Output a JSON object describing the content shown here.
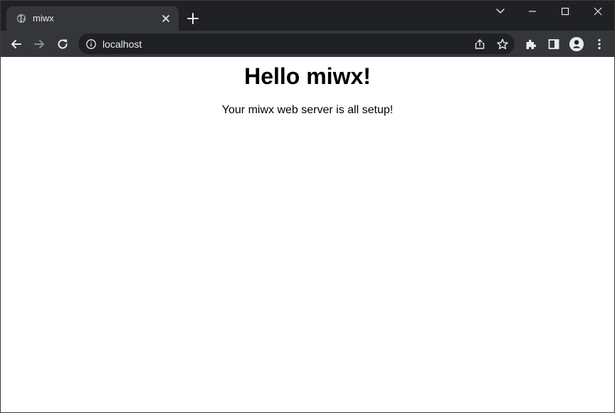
{
  "browser": {
    "tab": {
      "title": "miwx",
      "favicon": "globe-icon"
    },
    "address_bar": {
      "url": "localhost",
      "site_info_icon": "info-icon"
    },
    "toolbar_icons": [
      "back-icon",
      "forward-icon",
      "reload-icon",
      "share-icon",
      "star-icon",
      "puzzle-icon",
      "side-panel-icon",
      "profile-icon",
      "menu-dots-icon"
    ],
    "window_controls": [
      "tab-search-icon",
      "minimize-icon",
      "maximize-icon",
      "close-icon"
    ]
  },
  "page": {
    "heading": "Hello miwx!",
    "text": "Your miwx web server is all setup!"
  },
  "colors": {
    "titlebar": "#202124",
    "toolbar": "#35363a",
    "omnibox": "#202124",
    "icon": "#e8eaed",
    "page_background": "#ffffff"
  }
}
